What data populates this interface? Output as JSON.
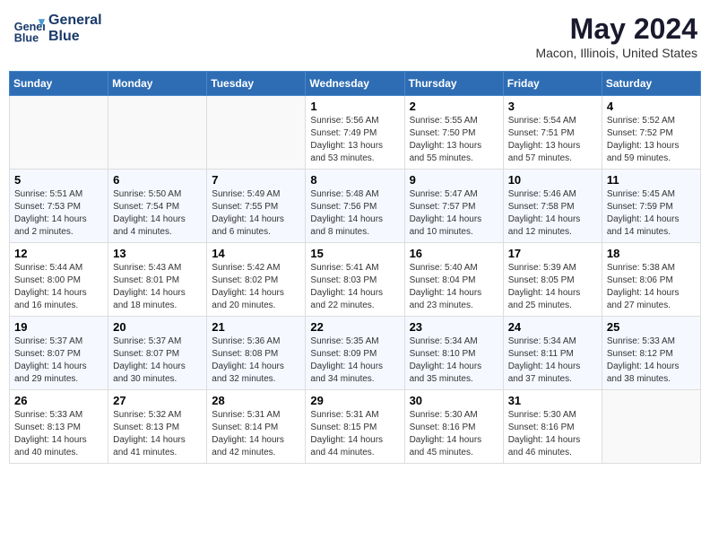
{
  "header": {
    "logo_line1": "General",
    "logo_line2": "Blue",
    "title": "May 2024",
    "subtitle": "Macon, Illinois, United States"
  },
  "days_of_week": [
    "Sunday",
    "Monday",
    "Tuesday",
    "Wednesday",
    "Thursday",
    "Friday",
    "Saturday"
  ],
  "weeks": [
    [
      {
        "day": "",
        "info": ""
      },
      {
        "day": "",
        "info": ""
      },
      {
        "day": "",
        "info": ""
      },
      {
        "day": "1",
        "info": "Sunrise: 5:56 AM\nSunset: 7:49 PM\nDaylight: 13 hours\nand 53 minutes."
      },
      {
        "day": "2",
        "info": "Sunrise: 5:55 AM\nSunset: 7:50 PM\nDaylight: 13 hours\nand 55 minutes."
      },
      {
        "day": "3",
        "info": "Sunrise: 5:54 AM\nSunset: 7:51 PM\nDaylight: 13 hours\nand 57 minutes."
      },
      {
        "day": "4",
        "info": "Sunrise: 5:52 AM\nSunset: 7:52 PM\nDaylight: 13 hours\nand 59 minutes."
      }
    ],
    [
      {
        "day": "5",
        "info": "Sunrise: 5:51 AM\nSunset: 7:53 PM\nDaylight: 14 hours\nand 2 minutes."
      },
      {
        "day": "6",
        "info": "Sunrise: 5:50 AM\nSunset: 7:54 PM\nDaylight: 14 hours\nand 4 minutes."
      },
      {
        "day": "7",
        "info": "Sunrise: 5:49 AM\nSunset: 7:55 PM\nDaylight: 14 hours\nand 6 minutes."
      },
      {
        "day": "8",
        "info": "Sunrise: 5:48 AM\nSunset: 7:56 PM\nDaylight: 14 hours\nand 8 minutes."
      },
      {
        "day": "9",
        "info": "Sunrise: 5:47 AM\nSunset: 7:57 PM\nDaylight: 14 hours\nand 10 minutes."
      },
      {
        "day": "10",
        "info": "Sunrise: 5:46 AM\nSunset: 7:58 PM\nDaylight: 14 hours\nand 12 minutes."
      },
      {
        "day": "11",
        "info": "Sunrise: 5:45 AM\nSunset: 7:59 PM\nDaylight: 14 hours\nand 14 minutes."
      }
    ],
    [
      {
        "day": "12",
        "info": "Sunrise: 5:44 AM\nSunset: 8:00 PM\nDaylight: 14 hours\nand 16 minutes."
      },
      {
        "day": "13",
        "info": "Sunrise: 5:43 AM\nSunset: 8:01 PM\nDaylight: 14 hours\nand 18 minutes."
      },
      {
        "day": "14",
        "info": "Sunrise: 5:42 AM\nSunset: 8:02 PM\nDaylight: 14 hours\nand 20 minutes."
      },
      {
        "day": "15",
        "info": "Sunrise: 5:41 AM\nSunset: 8:03 PM\nDaylight: 14 hours\nand 22 minutes."
      },
      {
        "day": "16",
        "info": "Sunrise: 5:40 AM\nSunset: 8:04 PM\nDaylight: 14 hours\nand 23 minutes."
      },
      {
        "day": "17",
        "info": "Sunrise: 5:39 AM\nSunset: 8:05 PM\nDaylight: 14 hours\nand 25 minutes."
      },
      {
        "day": "18",
        "info": "Sunrise: 5:38 AM\nSunset: 8:06 PM\nDaylight: 14 hours\nand 27 minutes."
      }
    ],
    [
      {
        "day": "19",
        "info": "Sunrise: 5:37 AM\nSunset: 8:07 PM\nDaylight: 14 hours\nand 29 minutes."
      },
      {
        "day": "20",
        "info": "Sunrise: 5:37 AM\nSunset: 8:07 PM\nDaylight: 14 hours\nand 30 minutes."
      },
      {
        "day": "21",
        "info": "Sunrise: 5:36 AM\nSunset: 8:08 PM\nDaylight: 14 hours\nand 32 minutes."
      },
      {
        "day": "22",
        "info": "Sunrise: 5:35 AM\nSunset: 8:09 PM\nDaylight: 14 hours\nand 34 minutes."
      },
      {
        "day": "23",
        "info": "Sunrise: 5:34 AM\nSunset: 8:10 PM\nDaylight: 14 hours\nand 35 minutes."
      },
      {
        "day": "24",
        "info": "Sunrise: 5:34 AM\nSunset: 8:11 PM\nDaylight: 14 hours\nand 37 minutes."
      },
      {
        "day": "25",
        "info": "Sunrise: 5:33 AM\nSunset: 8:12 PM\nDaylight: 14 hours\nand 38 minutes."
      }
    ],
    [
      {
        "day": "26",
        "info": "Sunrise: 5:33 AM\nSunset: 8:13 PM\nDaylight: 14 hours\nand 40 minutes."
      },
      {
        "day": "27",
        "info": "Sunrise: 5:32 AM\nSunset: 8:13 PM\nDaylight: 14 hours\nand 41 minutes."
      },
      {
        "day": "28",
        "info": "Sunrise: 5:31 AM\nSunset: 8:14 PM\nDaylight: 14 hours\nand 42 minutes."
      },
      {
        "day": "29",
        "info": "Sunrise: 5:31 AM\nSunset: 8:15 PM\nDaylight: 14 hours\nand 44 minutes."
      },
      {
        "day": "30",
        "info": "Sunrise: 5:30 AM\nSunset: 8:16 PM\nDaylight: 14 hours\nand 45 minutes."
      },
      {
        "day": "31",
        "info": "Sunrise: 5:30 AM\nSunset: 8:16 PM\nDaylight: 14 hours\nand 46 minutes."
      },
      {
        "day": "",
        "info": ""
      }
    ]
  ]
}
